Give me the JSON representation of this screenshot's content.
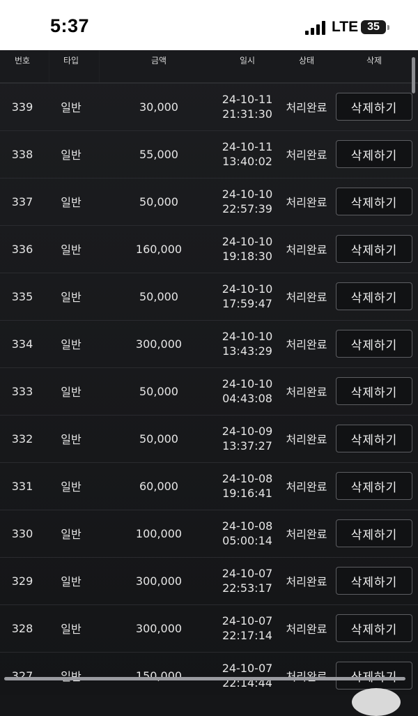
{
  "status_bar": {
    "time": "5:37",
    "network": "LTE",
    "battery": "35"
  },
  "table": {
    "headers": {
      "no": "번호",
      "type": "타입",
      "amount": "금액",
      "datetime": "일시",
      "status": "상태",
      "delete": "삭제"
    },
    "rows": [
      {
        "no": "339",
        "type": "일반",
        "amount": "30,000",
        "date": "24-10-11",
        "time": "21:31:30",
        "status": "처리완료",
        "action": "삭제하기"
      },
      {
        "no": "338",
        "type": "일반",
        "amount": "55,000",
        "date": "24-10-11",
        "time": "13:40:02",
        "status": "처리완료",
        "action": "삭제하기"
      },
      {
        "no": "337",
        "type": "일반",
        "amount": "50,000",
        "date": "24-10-10",
        "time": "22:57:39",
        "status": "처리완료",
        "action": "삭제하기"
      },
      {
        "no": "336",
        "type": "일반",
        "amount": "160,000",
        "date": "24-10-10",
        "time": "19:18:30",
        "status": "처리완료",
        "action": "삭제하기"
      },
      {
        "no": "335",
        "type": "일반",
        "amount": "50,000",
        "date": "24-10-10",
        "time": "17:59:47",
        "status": "처리완료",
        "action": "삭제하기"
      },
      {
        "no": "334",
        "type": "일반",
        "amount": "300,000",
        "date": "24-10-10",
        "time": "13:43:29",
        "status": "처리완료",
        "action": "삭제하기"
      },
      {
        "no": "333",
        "type": "일반",
        "amount": "50,000",
        "date": "24-10-10",
        "time": "04:43:08",
        "status": "처리완료",
        "action": "삭제하기"
      },
      {
        "no": "332",
        "type": "일반",
        "amount": "50,000",
        "date": "24-10-09",
        "time": "13:37:27",
        "status": "처리완료",
        "action": "삭제하기"
      },
      {
        "no": "331",
        "type": "일반",
        "amount": "60,000",
        "date": "24-10-08",
        "time": "19:16:41",
        "status": "처리완료",
        "action": "삭제하기"
      },
      {
        "no": "330",
        "type": "일반",
        "amount": "100,000",
        "date": "24-10-08",
        "time": "05:00:14",
        "status": "처리완료",
        "action": "삭제하기"
      },
      {
        "no": "329",
        "type": "일반",
        "amount": "300,000",
        "date": "24-10-07",
        "time": "22:53:17",
        "status": "처리완료",
        "action": "삭제하기"
      },
      {
        "no": "328",
        "type": "일반",
        "amount": "300,000",
        "date": "24-10-07",
        "time": "22:17:14",
        "status": "처리완료",
        "action": "삭제하기"
      },
      {
        "no": "327",
        "type": "일반",
        "amount": "150,000",
        "date": "24-10-07",
        "time": "22:14:44",
        "status": "처리완료",
        "action": "삭제하기"
      }
    ]
  }
}
